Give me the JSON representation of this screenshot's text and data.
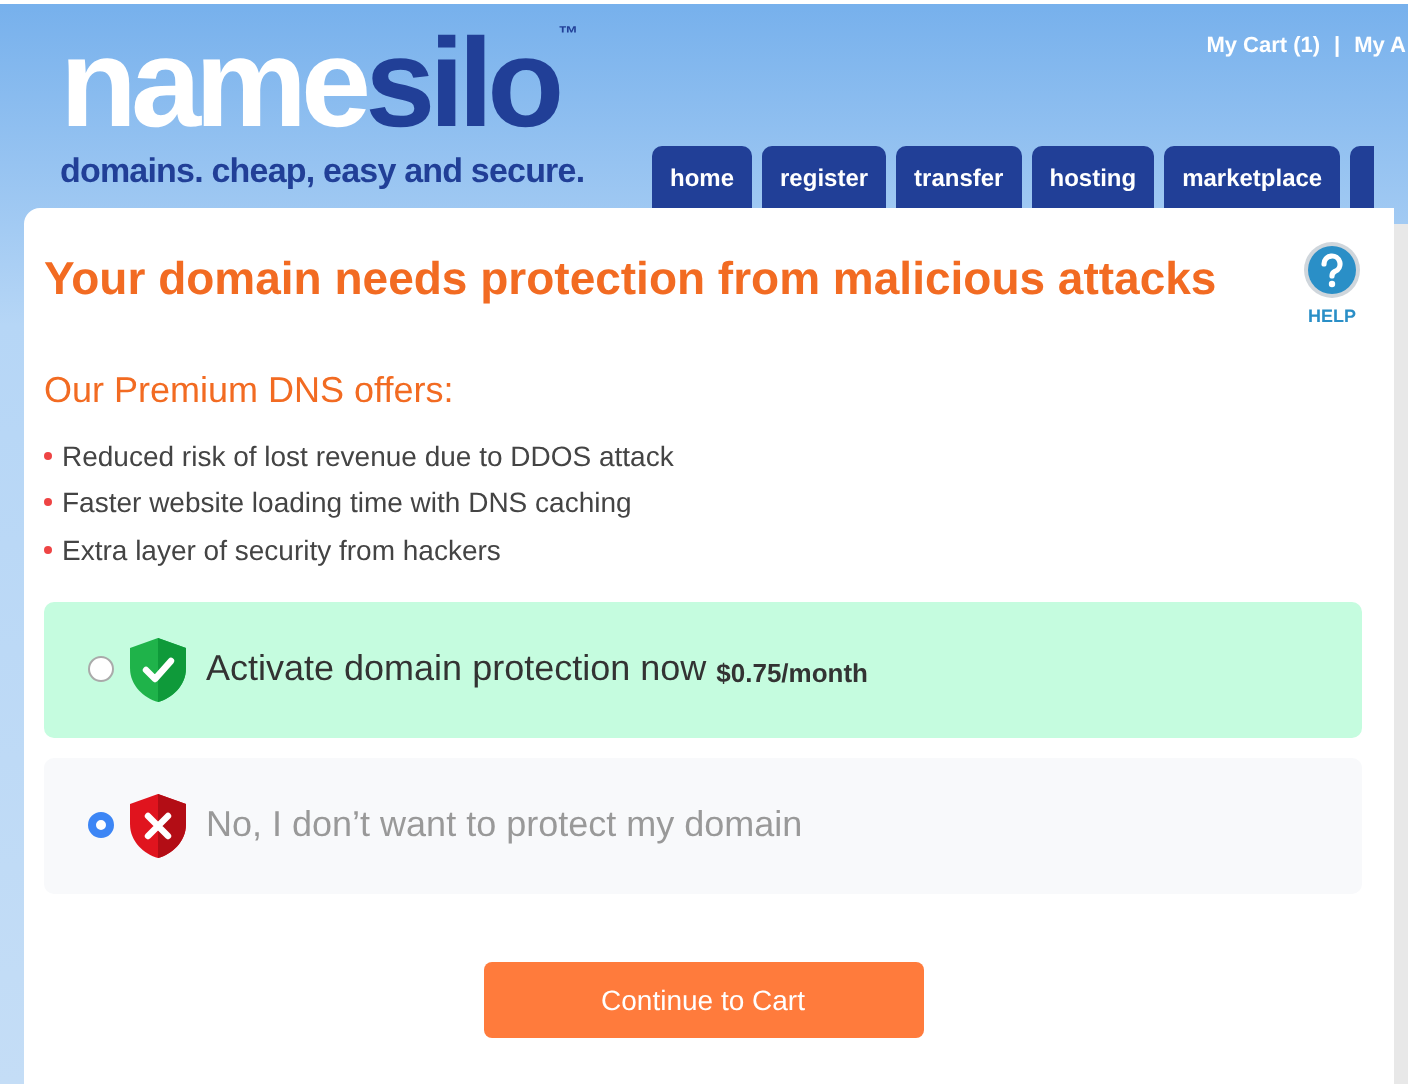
{
  "header": {
    "logo": {
      "first": "name",
      "second": "silo",
      "mark": "™"
    },
    "tagline": "domains. cheap, easy and secure.",
    "links": [
      "My Cart (1)",
      "|",
      "My A"
    ],
    "tabs": [
      {
        "label": "home"
      },
      {
        "label": "register"
      },
      {
        "label": "transfer"
      },
      {
        "label": "hosting"
      },
      {
        "label": "marketplace"
      }
    ]
  },
  "main": {
    "title": "Your domain needs protection from malicious attacks",
    "help": "HELP",
    "subtitle": "Our Premium DNS offers:",
    "bullets": [
      "Reduced risk of lost revenue due to DDOS attack",
      "Faster website loading time with DNS caching",
      "Extra layer of security from hackers"
    ],
    "options": [
      {
        "kind": "accept",
        "label": "Activate domain protection now",
        "price": "$0.75/month",
        "selected": false
      },
      {
        "kind": "decline",
        "label": "No, I don’t want to protect my domain",
        "selected": true
      }
    ],
    "button": "Continue to Cart"
  }
}
